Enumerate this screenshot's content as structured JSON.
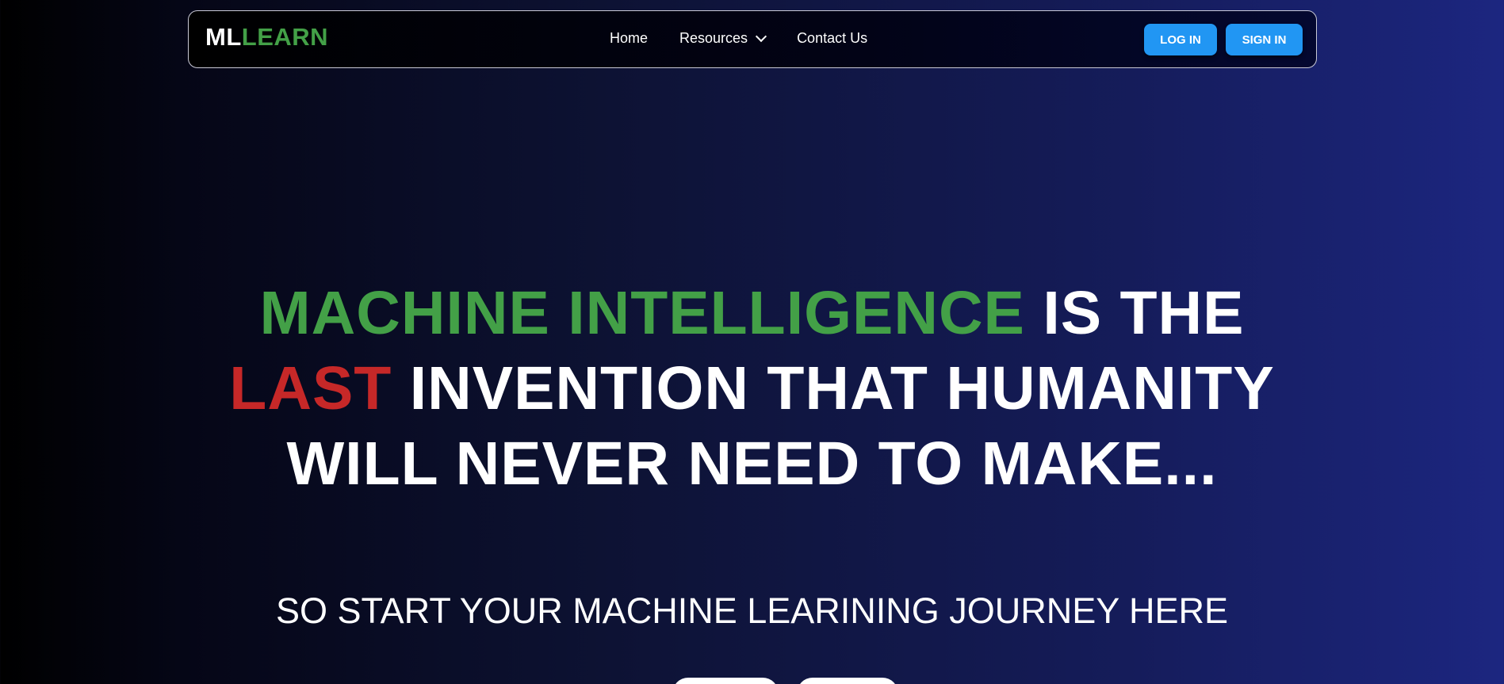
{
  "navbar": {
    "logo_primary": "ML",
    "logo_secondary": "LEARN",
    "links": [
      "Home",
      "Resources",
      "Contact Us"
    ],
    "resources_icon": "chevron-down-icon",
    "login_label": "LOG IN",
    "signin_label": "SIGN IN"
  },
  "hero": {
    "line1_highlight": "MACHINE INTELLIGENCE",
    "line1_rest": " IS THE",
    "line2_highlight": "LAST",
    "line2_rest": " INVENTION THAT HUMANITY",
    "line3": "WILL NEVER NEED TO MAKE...",
    "subtitle": "SO START YOUR MACHINE LEARINING JOURNEY HERE"
  },
  "colors": {
    "accent_green": "#43a047",
    "accent_red": "#c62828",
    "button_blue": "#2196f3",
    "background_start": "#000000",
    "background_end": "#1c2680"
  }
}
